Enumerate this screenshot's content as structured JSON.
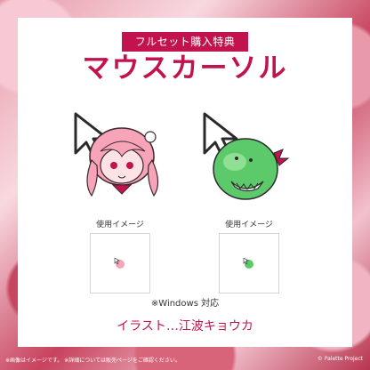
{
  "header": {
    "badge": "フルセット購入特典",
    "title": "マウスカーソル"
  },
  "cursors": [
    {
      "name": "pink-haired-chibi",
      "usage_label": "使用イメージ"
    },
    {
      "name": "green-dino-mascot",
      "usage_label": "使用イメージ"
    }
  ],
  "os_note": "※Windows 対応",
  "credit": "イラスト…江波キョウカ",
  "footer": {
    "note": "※画像はイメージです。 ※詳細については販売ページをご確認ください。",
    "copyright": "© Palette Project"
  },
  "colors": {
    "accent": "#c3134f",
    "pink_hair": "#f7a3b8",
    "dino_green": "#5cc96a"
  },
  "icons": [
    "arrow-cursor-icon",
    "character-icon",
    "dino-icon"
  ]
}
